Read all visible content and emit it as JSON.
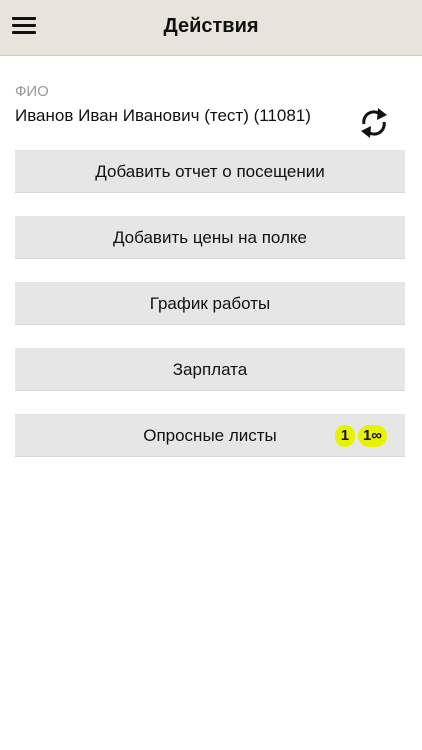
{
  "header": {
    "title": "Действия",
    "menu_icon": "hamburger-icon"
  },
  "user": {
    "label": "ФИО",
    "name": "Иванов Иван Иванович (тест) (11081)",
    "refresh_icon": "refresh-icon"
  },
  "actions": [
    {
      "label": "Добавить отчет о посещении"
    },
    {
      "label": "Добавить цены на полке"
    },
    {
      "label": "График работы"
    },
    {
      "label": "Зарплата"
    },
    {
      "label": "Опросные листы",
      "badges": [
        "1",
        "1∞"
      ]
    }
  ],
  "colors": {
    "header_bg": "#e9e4db",
    "button_bg": "#e6e6e6",
    "badge_bg": "#e6f200",
    "label_gray": "#9a9a9a"
  }
}
